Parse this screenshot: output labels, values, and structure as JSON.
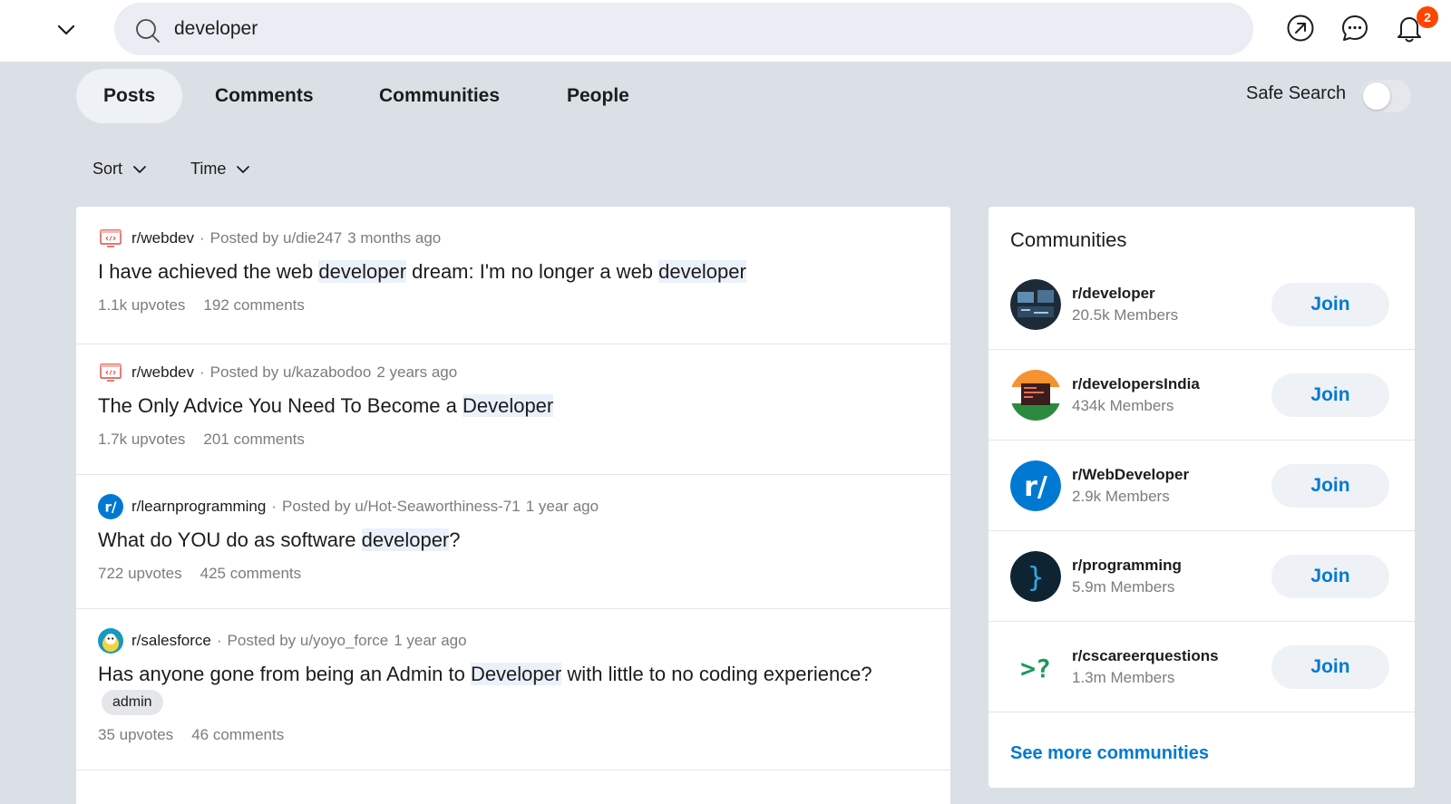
{
  "header": {
    "search_value": "developer",
    "notification_count": "2",
    "icons": [
      "chevron-down-icon",
      "search-icon",
      "popular-icon",
      "chat-icon",
      "bell-icon"
    ]
  },
  "tabs": [
    {
      "label": "Posts",
      "active": true
    },
    {
      "label": "Comments",
      "active": false
    },
    {
      "label": "Communities",
      "active": false
    },
    {
      "label": "People",
      "active": false
    }
  ],
  "safe_search": {
    "label": "Safe Search",
    "enabled": false
  },
  "filters": {
    "sort": "Sort",
    "time": "Time"
  },
  "posts": [
    {
      "subreddit": "r/webdev",
      "posted_by": "Posted by u/die247",
      "age": "3 months ago",
      "title_parts": [
        "I have achieved the web ",
        "developer",
        " dream: I'm no longer a web ",
        "developer",
        ""
      ],
      "flair": "",
      "upvotes": "1.1k upvotes",
      "comments": "192 comments"
    },
    {
      "subreddit": "r/webdev",
      "posted_by": "Posted by u/kazabodoo",
      "age": "2 years ago",
      "title_parts": [
        "The Only Advice You Need To Become a ",
        "Developer",
        ""
      ],
      "flair": "",
      "upvotes": "1.7k upvotes",
      "comments": "201 comments"
    },
    {
      "subreddit": "r/learnprogramming",
      "posted_by": "Posted by u/Hot-Seaworthiness-71",
      "age": "1 year ago",
      "title_parts": [
        "What do YOU do as software ",
        "developer",
        "?"
      ],
      "flair": "",
      "upvotes": "722 upvotes",
      "comments": "425 comments"
    },
    {
      "subreddit": "r/salesforce",
      "posted_by": "Posted by u/yoyo_force",
      "age": "1 year ago",
      "title_parts": [
        "Has anyone gone from being an Admin to ",
        "Developer",
        " with little to no coding experience?"
      ],
      "flair": "admin",
      "upvotes": "35 upvotes",
      "comments": "46 comments"
    }
  ],
  "communities": {
    "title": "Communities",
    "join_label": "Join",
    "see_more": "See more communities",
    "items": [
      {
        "name": "r/developer",
        "members": "20.5k Members"
      },
      {
        "name": "r/developersIndia",
        "members": "434k Members"
      },
      {
        "name": "r/WebDeveloper",
        "members": "2.9k Members"
      },
      {
        "name": "r/programming",
        "members": "5.9m Members"
      },
      {
        "name": "r/cscareerquestions",
        "members": "1.3m Members"
      }
    ]
  },
  "colors": {
    "accent_blue": "#0079d3",
    "notification_orange": "#ff4500",
    "page_bg": "#dae0e6"
  }
}
